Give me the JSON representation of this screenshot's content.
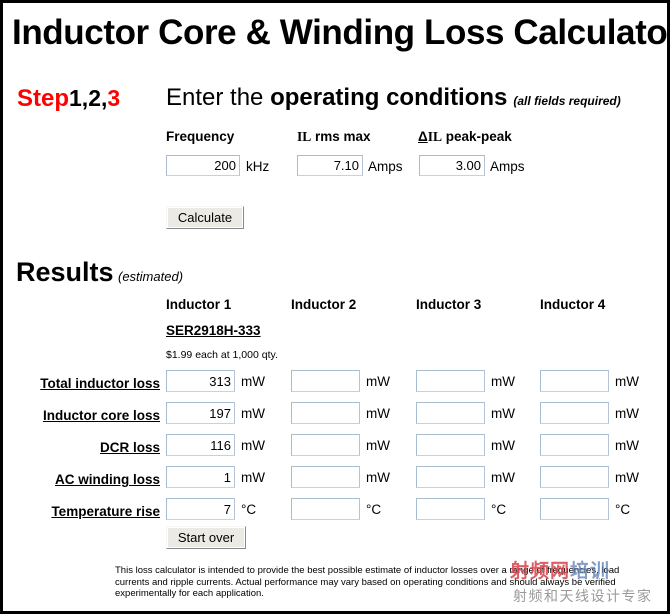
{
  "page": {
    "title": "Inductor Core & Winding Loss Calculator"
  },
  "step": {
    "word": "Step",
    "numbers_black": "1,2,",
    "numbers_red": "3",
    "instruction_plain": "Enter the ",
    "instruction_bold": "operating conditions",
    "note": "(all fields required)"
  },
  "conditions": {
    "fields": [
      {
        "label_prefix": "",
        "label_symbol": "",
        "label": "Frequency",
        "value": "200",
        "unit": "kHz",
        "name": "frequency"
      },
      {
        "label_prefix": "",
        "label_symbol": "IL",
        "label": " rms max",
        "value": "7.10",
        "unit": "Amps",
        "name": "il-rms-max"
      },
      {
        "label_prefix": "Δ",
        "label_symbol": "IL",
        "label": " peak-peak",
        "value": "3.00",
        "unit": "Amps",
        "name": "delta-il-peak-peak"
      }
    ],
    "calculate_label": "Calculate"
  },
  "results": {
    "heading": "Results",
    "heading_note": "(estimated)",
    "columns": [
      {
        "header": "Inductor 1",
        "part_number": "SER2918H-333",
        "price": "$1.99 each at 1,000 qty."
      },
      {
        "header": "Inductor 2",
        "part_number": "",
        "price": ""
      },
      {
        "header": "Inductor 3",
        "part_number": "",
        "price": ""
      },
      {
        "header": "Inductor 4",
        "part_number": "",
        "price": ""
      }
    ],
    "rows": [
      {
        "label": "Total inductor loss",
        "unit": "mW",
        "values": [
          "313",
          "",
          "",
          ""
        ]
      },
      {
        "label": "Inductor core loss",
        "unit": "mW",
        "values": [
          "197",
          "",
          "",
          ""
        ]
      },
      {
        "label": "DCR loss",
        "unit": "mW",
        "values": [
          "116",
          "",
          "",
          ""
        ]
      },
      {
        "label": "AC winding loss",
        "unit": "mW",
        "values": [
          "1",
          "",
          "",
          ""
        ]
      },
      {
        "label": "Temperature rise",
        "unit": "°C",
        "values": [
          "7",
          "",
          "",
          ""
        ]
      }
    ],
    "start_over_label": "Start over"
  },
  "disclaimer": {
    "text": "This loss calculator is intended to provide the best possible estimate of inductor losses over a range of frequencies, load currents and ripple currents. Actual performance may vary based on operating conditions and should always be verified experimentally for each application."
  },
  "watermark": {
    "logo_red": "射频网",
    "logo_blue": "培训",
    "subtitle": "射频和天线设计专家"
  },
  "colors": {
    "accent_red": "#ff0000",
    "input_border": "#a8bcd0",
    "button_face": "#eceae4",
    "watermark_gray": "#9a9a9a"
  }
}
